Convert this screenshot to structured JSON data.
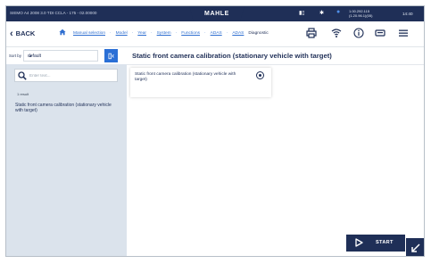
{
  "status_bar": {
    "vehicle_info": "SIEMO A4 2008 3.0 TDI CCLA - 175 - 02.00000",
    "brand": "MAHLE",
    "voltage": "1.00.292.115",
    "voltage_sub": "(1.20.96.1)(05)",
    "time": "14:40"
  },
  "nav": {
    "back_label": "BACK",
    "breadcrumbs": [
      "Manual selection",
      "Model",
      "Year",
      "System",
      "Functions",
      "ADAS",
      "ADAS"
    ],
    "breadcrumb_current": "Diagnostic"
  },
  "sidebar": {
    "sort_label": "Sort by",
    "sort_value": "default",
    "search_placeholder": "Enter text...",
    "results_count": "1 result",
    "result_items": [
      "Static front camera calibration (stationary vehicle with target)"
    ]
  },
  "main": {
    "title": "Static front camera calibration (stationary vehicle with target)",
    "options": [
      {
        "label": "Static front camera calibration (stationary vehicle with target)",
        "selected": true
      }
    ],
    "start_label": "START"
  },
  "colors": {
    "navy": "#1f2f57",
    "accent_blue": "#2a6fd6",
    "sidebar_bg": "#dbe3ec",
    "link": "#2f6fd0"
  },
  "icons": [
    "home-icon",
    "printer-icon",
    "wifi-icon",
    "info-icon",
    "vci-icon",
    "menu-icon",
    "search-icon",
    "collapse-icon",
    "play-icon",
    "expand-corner-icon",
    "battery-icon",
    "bluetooth-icon"
  ]
}
